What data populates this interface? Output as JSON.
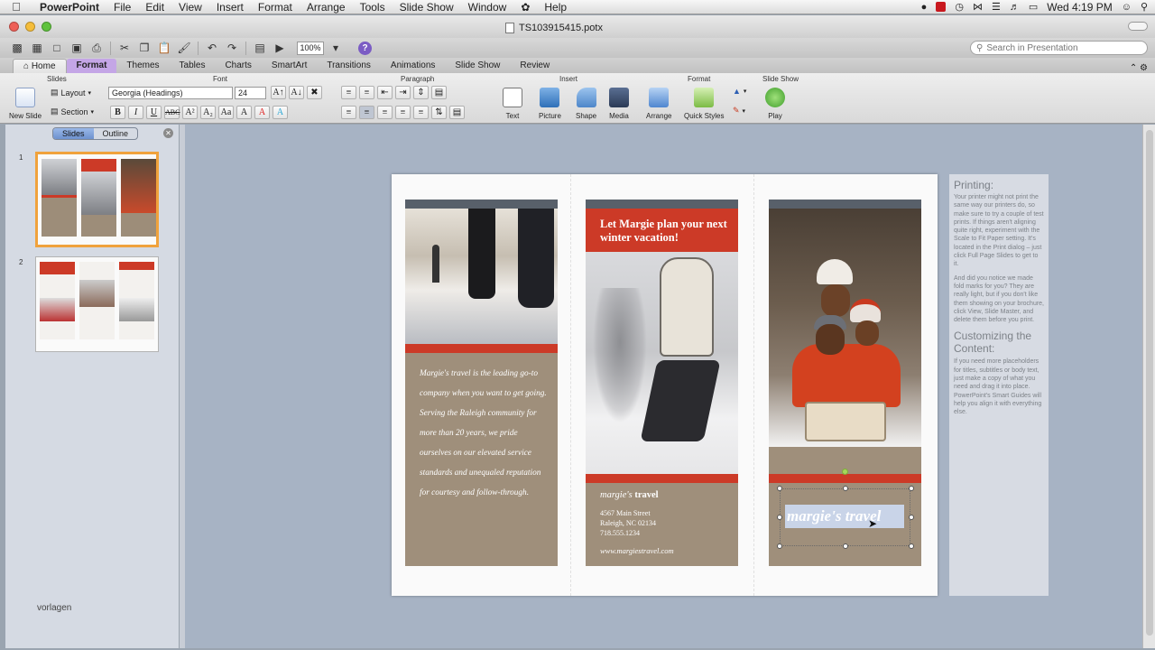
{
  "menubar": {
    "app_name": "PowerPoint",
    "items": [
      "File",
      "Edit",
      "View",
      "Insert",
      "Format",
      "Arrange",
      "Tools",
      "Slide Show",
      "Window",
      "Help"
    ],
    "clock": "Wed 4:19 PM"
  },
  "window": {
    "title": "TS103915415.potx"
  },
  "toolbar": {
    "zoom": "100%",
    "search_placeholder": "Search in Presentation"
  },
  "ribbon": {
    "tabs": [
      "Home",
      "Format",
      "Themes",
      "Tables",
      "Charts",
      "SmartArt",
      "Transitions",
      "Animations",
      "Slide Show",
      "Review"
    ],
    "active_tab": "Format",
    "groups": {
      "slides": "Slides",
      "font": "Font",
      "paragraph": "Paragraph",
      "insert": "Insert",
      "format": "Format",
      "slideshow": "Slide Show"
    },
    "buttons": {
      "new_slide": "New Slide",
      "layout": "Layout",
      "section": "Section",
      "text": "Text",
      "picture": "Picture",
      "shape": "Shape",
      "media": "Media",
      "arrange": "Arrange",
      "quick_styles": "Quick Styles",
      "play": "Play"
    },
    "font_name": "Georgia (Headings)",
    "font_size": "24"
  },
  "sidebar": {
    "tabs": [
      "Slides",
      "Outline"
    ],
    "active_tab": "Slides",
    "slide_numbers": [
      "1",
      "2"
    ],
    "watermark": "vorlagen"
  },
  "slide": {
    "intro_text": "Margie's travel is the leading go-to company when you want to get going. Serving the Raleigh community for more than 20 years, we pride ourselves on our elevated service standards and unequaled reputation for courtesy and follow-through.",
    "headline": "Let Margie plan  your next winter vacation!",
    "brand_italic": "margie's",
    "brand_bold": "travel",
    "address_lines": [
      "4567 Main Street",
      "Raleigh, NC 02134",
      "718.555.1234"
    ],
    "website": "www.margiestravel.com",
    "tagline": "margie's travel"
  },
  "notes": {
    "heading1": "Printing:",
    "para1": "Your printer might not print the same way our printers do, so make sure to try a couple of test prints. If things aren't aligning quite right, experiment with the Scale to Fit Paper setting. It's located in the Print dialog – just click Full Page Slides to get to it.",
    "para2": "And did you notice we made fold marks for you? They are really light, but if you don't like them showing on your brochure, click View, Slide Master, and delete them before you print.",
    "heading2": "Customizing the Content:",
    "para3": "If you need more placeholders for titles, subtitles or body text, just make a copy of what you need and drag it into place. PowerPoint's Smart Guides will help you align it with everything else."
  },
  "colors": {
    "accent_red": "#cc3a27",
    "panel_taupe": "#9f8f7b",
    "format_tab": "#c4a6e6"
  }
}
